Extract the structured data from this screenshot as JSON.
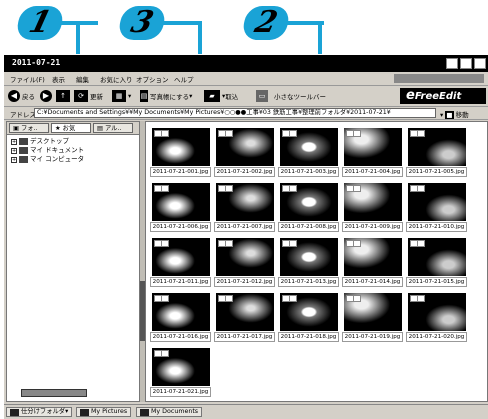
{
  "callouts": [
    "1",
    "3",
    "2"
  ],
  "window": {
    "title": "2011-07-21",
    "menu": [
      "ファイル(F)",
      "表示",
      "編集",
      "お気に入り",
      "オプション",
      "ヘルプ"
    ],
    "toolbar": {
      "back": "戻る",
      "refresh": "更新",
      "view_mode": "写真帳にする",
      "import": "取込",
      "small_toolbar": "小さなツールバー",
      "brand": "FreeEdit"
    },
    "address": {
      "label": "アドレス",
      "value": "C:¥Documents and Settings¥¥My Documents¥My Pictures¥○○●●工事¥03 鉄筋工事¥整理前フォルダ¥2011-07-21¥",
      "go": "移動"
    },
    "tabs": [
      "フォ..",
      "お気",
      "アル.."
    ],
    "tree": [
      {
        "label": "デスクトップ"
      },
      {
        "label": "マイ ドキュメント"
      },
      {
        "label": "マイ コンピュータ"
      }
    ],
    "thumbnails": [
      "2011-07-21-001.jpg",
      "2011-07-21-002.jpg",
      "2011-07-21-003.jpg",
      "2011-07-21-004.jpg",
      "2011-07-21-005.jpg",
      "2011-07-21-006.jpg",
      "2011-07-21-007.jpg",
      "2011-07-21-008.jpg",
      "2011-07-21-009.jpg",
      "2011-07-21-010.jpg",
      "2011-07-21-011.jpg",
      "2011-07-21-012.jpg",
      "2011-07-21-013.jpg",
      "2011-07-21-014.jpg",
      "2011-07-21-015.jpg",
      "2011-07-21-016.jpg",
      "2011-07-21-017.jpg",
      "2011-07-21-018.jpg",
      "2011-07-21-019.jpg",
      "2011-07-21-020.jpg",
      "2011-07-21-021.jpg"
    ],
    "status_tabs": [
      "仕分けフォルダ",
      "My Pictures",
      "My Documents"
    ]
  },
  "colors": {
    "accent": "#1aa3d6"
  }
}
